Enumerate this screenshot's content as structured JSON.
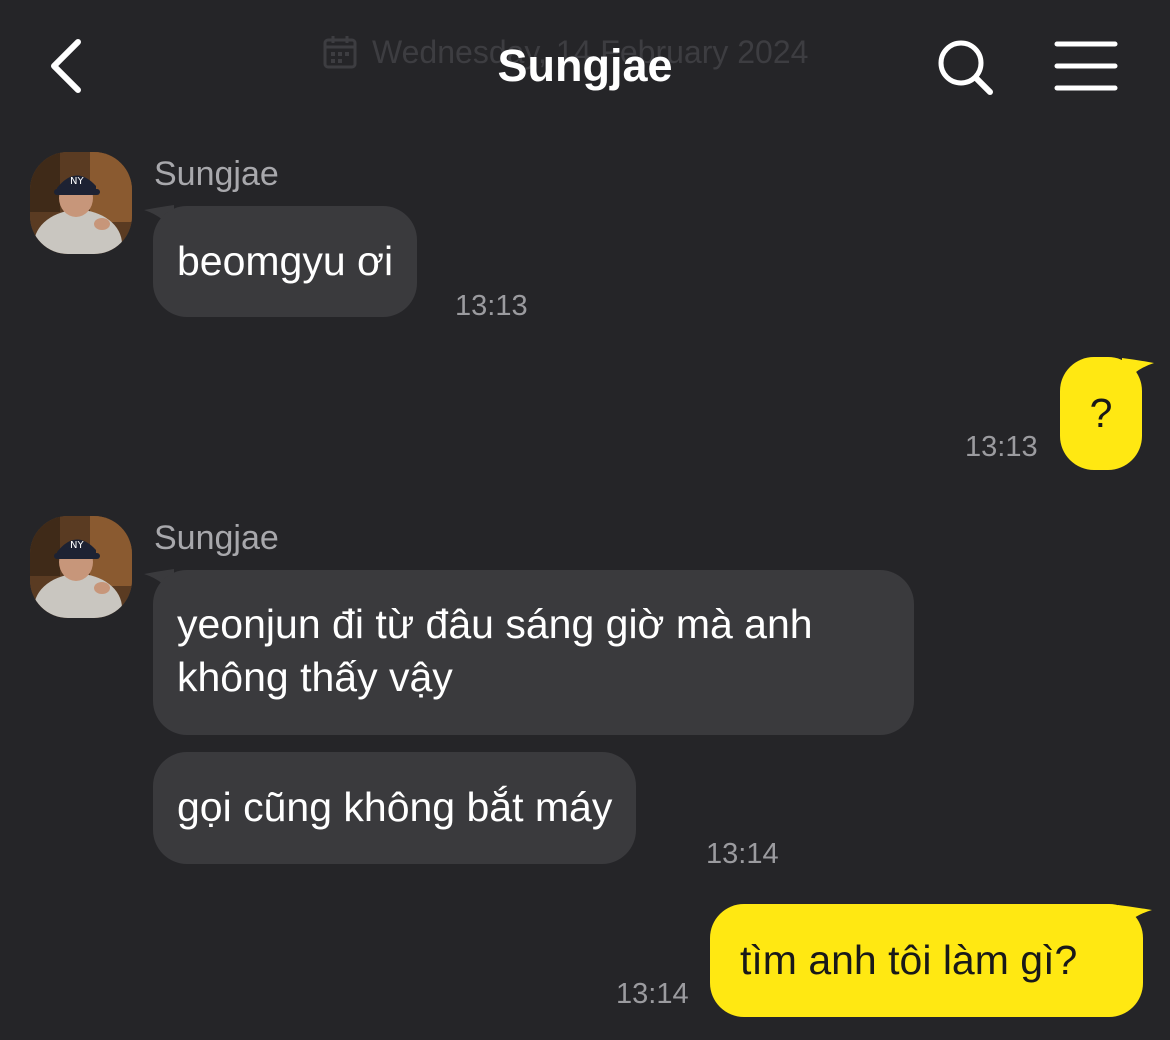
{
  "header": {
    "date_sticky": "Wednesday, 14 February 2024",
    "title": "Sungjae",
    "icons": {
      "back": "chevron-left-icon",
      "search": "search-icon",
      "menu": "hamburger-menu-icon",
      "calendar": "calendar-icon"
    }
  },
  "colors": {
    "background": "#252528",
    "incoming_bubble": "#3a3a3d",
    "outgoing_bubble": "#ffe812",
    "outgoing_text": "#191919",
    "timestamp": "#9b9b9f",
    "sender_name": "#a8a8ac"
  },
  "messages": [
    {
      "direction": "in",
      "sender": "Sungjae",
      "text": "beomgyu ơi",
      "time": "13:13"
    },
    {
      "direction": "out",
      "text": "?",
      "time": "13:13"
    },
    {
      "direction": "in",
      "sender": "Sungjae",
      "lines": [
        "yeonjun đi từ đâu sáng giờ mà anh",
        "không thấy vậy"
      ]
    },
    {
      "direction": "in",
      "text": "gọi cũng không bắt máy",
      "time": "13:14"
    },
    {
      "direction": "out",
      "text": "tìm anh tôi làm gì?",
      "time": "13:14"
    }
  ]
}
